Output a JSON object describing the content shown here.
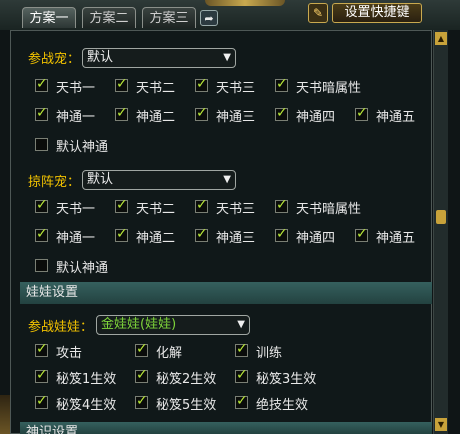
{
  "tabs": [
    {
      "label": "方案一",
      "active": true
    },
    {
      "label": "方案二",
      "active": false
    },
    {
      "label": "方案三",
      "active": false
    }
  ],
  "toolbar": {
    "arrow_icon": "redo-arrow-icon",
    "pencil_icon": "pencil-icon",
    "hotkey_label": "设置快捷键"
  },
  "battle_pet": {
    "label": "参战宠：",
    "selected": "默认",
    "options_row1": [
      "天书一",
      "天书二",
      "天书三",
      "天书暗属性"
    ],
    "options_row2": [
      "神通一",
      "神通二",
      "神通三",
      "神通四",
      "神通五"
    ],
    "default_label": "默认神通",
    "row1_checked": [
      true,
      true,
      true,
      true
    ],
    "row2_checked": [
      true,
      true,
      true,
      true,
      true
    ],
    "default_checked": false
  },
  "formation_pet": {
    "label": "掠阵宠：",
    "selected": "默认",
    "options_row1": [
      "天书一",
      "天书二",
      "天书三",
      "天书暗属性"
    ],
    "options_row2": [
      "神通一",
      "神通二",
      "神通三",
      "神通四",
      "神通五"
    ],
    "default_label": "默认神通",
    "row1_checked": [
      true,
      true,
      true,
      true
    ],
    "row2_checked": [
      true,
      true,
      true,
      true,
      true
    ],
    "default_checked": false
  },
  "doll_section": {
    "header": "娃娃设置",
    "label": "参战娃娃：",
    "selected": "金娃娃(娃娃)",
    "options": [
      [
        "攻击",
        "化解",
        "训练"
      ],
      [
        "秘笈1生效",
        "秘笈2生效",
        "秘笈3生效"
      ],
      [
        "秘笈4生效",
        "秘笈5生效",
        "绝技生效"
      ]
    ]
  },
  "next_section": {
    "header": "神识设置"
  },
  "colors": {
    "accent_yellow": "#f2c200",
    "check_green": "#b8e836",
    "section_teal": "#2c5250",
    "gold": "#c8a23a"
  }
}
